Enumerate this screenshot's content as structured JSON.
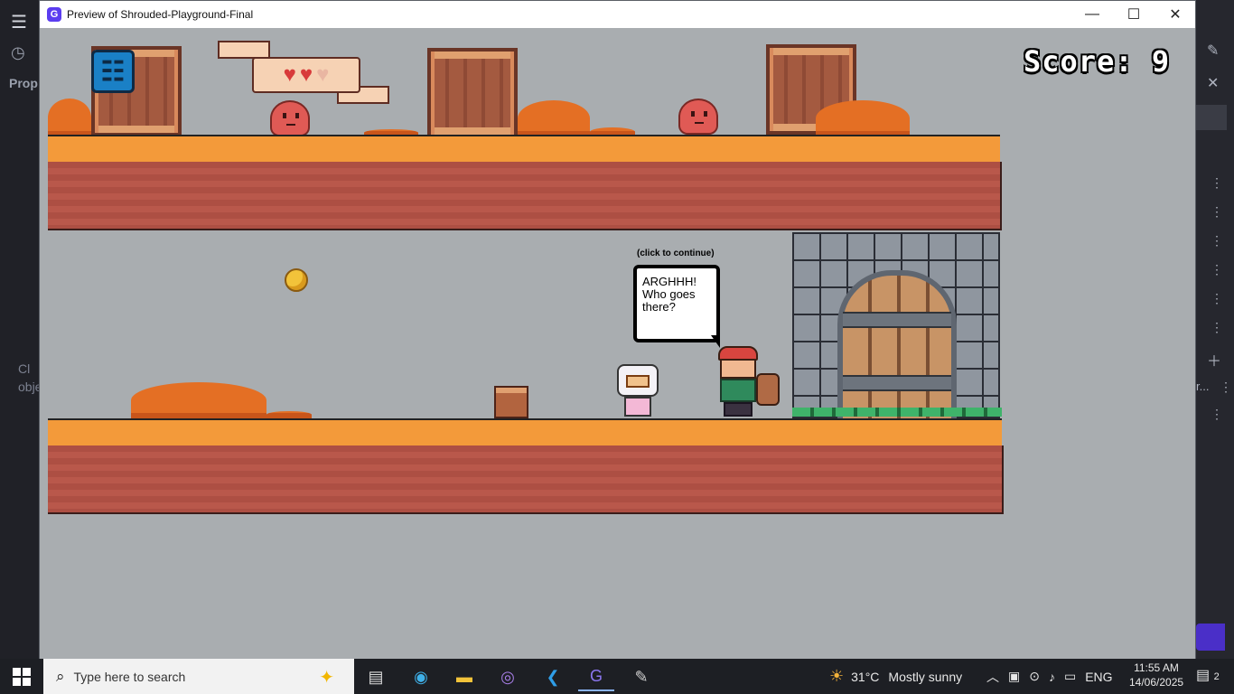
{
  "window": {
    "title": "Preview of Shrouded-Playground-Final",
    "icon": "gdevelop-logo-icon",
    "controls": [
      "minimize",
      "maximize",
      "close"
    ]
  },
  "editor_background": {
    "left_label_props": "Prop",
    "left_label_clip": "Cl\nobje",
    "right_label_trunc": "r..."
  },
  "game": {
    "score_label": "Score: 9",
    "hearts": [
      "full",
      "full",
      "empty"
    ],
    "dialog": {
      "hint": "(click to continue)",
      "text": "ARGHHH! Who goes there?"
    }
  },
  "taskbar": {
    "search_placeholder": "Type here to search",
    "apps": [
      "task-view-icon",
      "edge-icon",
      "file-explorer-icon",
      "github-desktop-icon",
      "vscode-icon",
      "gdevelop-icon",
      "paint-icon"
    ],
    "weather_temp": "31°C",
    "weather_desc": "Mostly sunny",
    "language": "ENG",
    "time": "11:55 AM",
    "date": "14/06/2025",
    "notification_count": "2"
  },
  "colors": {
    "sky": "#a9adb0",
    "grass": "#f39a3a",
    "dirt": "#ad4f43",
    "accent": "#5b3df0"
  }
}
